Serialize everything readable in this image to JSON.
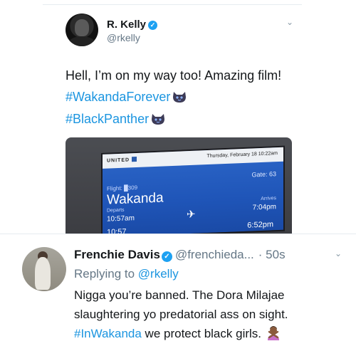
{
  "tweet1": {
    "author_name": "R. Kelly",
    "author_handle": "@rkelly",
    "text": "Hell, I’m on my way too! Amazing film!",
    "hashtags": [
      "#WakandaForever",
      "#BlackPanther"
    ],
    "verified_mark": "✓",
    "caret_icon": "chevron-down-icon",
    "caret_glyph": "⌄"
  },
  "photo": {
    "airline": "UNITED",
    "date_time": "Thursday, February 18   10:22am",
    "gate": "Gate: 63",
    "flight": "Flight: █309",
    "destination": "Wakanda",
    "departs_label": "Departs",
    "departs_time": "10:57am",
    "arrives_label": "Arrives",
    "arrives_time": "7:04pm",
    "next_arrives": "6:52pm",
    "next_departs": "10:57",
    "plane_glyph": "✈"
  },
  "reply": {
    "author_name": "Frenchie Davis",
    "author_handle": "@frenchieda...",
    "time": "· 50s",
    "replying_prefix": "Replying to",
    "replying_to": "@rkelly",
    "text_line1": "Nigga you’re banned. The Dora Milajae",
    "text_line2": "slaughtering yo predatorial ass on sight.",
    "hashtag": "#InWakanda",
    "text_line3_rest": " we protect black girls.",
    "verified_mark": "✓",
    "caret_glyph": "⌄"
  },
  "colors": {
    "link": "#1b95e0",
    "verified": "#1da1f2",
    "secondary_text": "#657786",
    "primary_text": "#14171a"
  }
}
